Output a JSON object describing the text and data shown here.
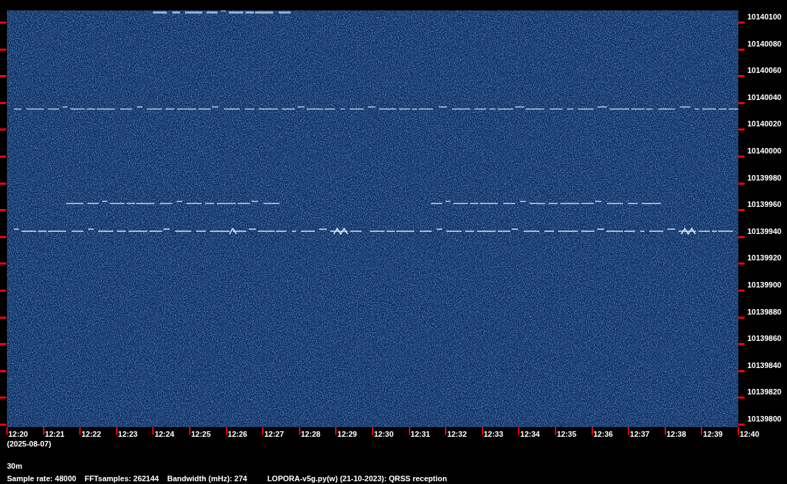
{
  "frequency_axis": {
    "labels": [
      "10140100",
      "10140080",
      "10140060",
      "10140040",
      "10140020",
      "10140000",
      "10139980",
      "10139960",
      "10139940",
      "10139920",
      "10139900",
      "10139880",
      "10139860",
      "10139840",
      "10139820",
      "10139800"
    ]
  },
  "time_axis": {
    "labels": [
      "12:20",
      "12:21",
      "12:22",
      "12:23",
      "12:24",
      "12:25",
      "12:26",
      "12:27",
      "12:28",
      "12:29",
      "12:30",
      "12:31",
      "12:32",
      "12:33",
      "12:34",
      "12:35",
      "12:36",
      "12:37",
      "12:38",
      "12:39",
      "12:40"
    ],
    "date": "(2025-08-07)"
  },
  "band": "30m",
  "info": [
    "Sample rate: 48000",
    "FFTsamples: 262144",
    "Bandwidth (mHz): 274"
  ],
  "program": "LOPORA-v5g.py(w) (21-10-2023): QRSS reception"
}
